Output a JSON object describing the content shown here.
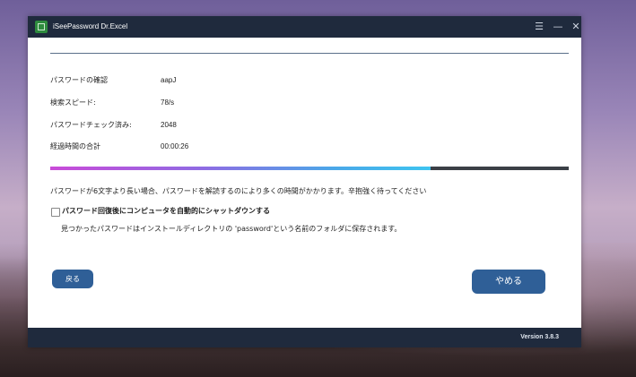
{
  "window": {
    "title": "iSeePassword Dr.Excel",
    "controls": {
      "menu": "☰",
      "minimize": "—",
      "close": "✕"
    }
  },
  "status": {
    "rows": [
      {
        "label": "パスワードの確認",
        "value": "aapJ"
      },
      {
        "label": "検索スピード:",
        "value": "78/s"
      },
      {
        "label": "パスワードチェック済み:",
        "value": "2048"
      },
      {
        "label": "経過時間の合計",
        "value": "00:00:26"
      }
    ],
    "progress": 0.734
  },
  "note": "パスワードが6文字より長い場合、パスワードを解読するのにより多くの時間がかかります。辛抱強く待ってください",
  "shutdown": {
    "label": "パスワード回復後にコンピュータを自動的にシャットダウンする",
    "checked": false
  },
  "save_note": "見つかったパスワードはインストールディレクトリの 'password'という名前のフォルダに保存されます。",
  "buttons": {
    "back": "戻る",
    "stop": "やめる"
  },
  "footer": {
    "version": "Version 3.8.3"
  },
  "colors": {
    "titlebar": "#1f2a3d",
    "button": "#2f5f97",
    "progress_start": "#c94bd8",
    "progress_end": "#3ec4f0",
    "progress_track": "#3b3f46"
  }
}
